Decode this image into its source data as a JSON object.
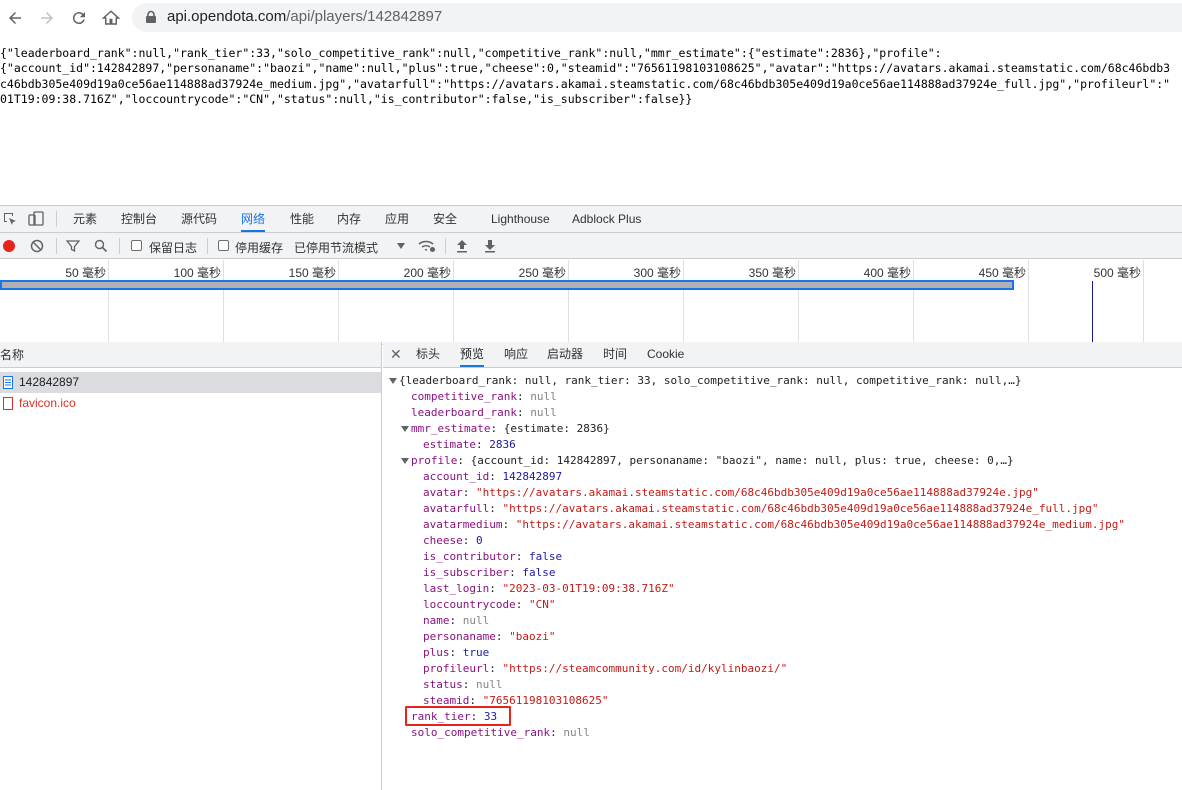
{
  "address_bar": {
    "host": "api.opendota.com",
    "path": "/api/players/142842897"
  },
  "raw_json_lines": [
    "{\"leaderboard_rank\":null,\"rank_tier\":33,\"solo_competitive_rank\":null,\"competitive_rank\":null,\"mmr_estimate\":{\"estimate\":2836},\"profile\":",
    "{\"account_id\":142842897,\"personaname\":\"baozi\",\"name\":null,\"plus\":true,\"cheese\":0,\"steamid\":\"76561198103108625\",\"avatar\":\"https://avatars.akamai.steamstatic.com/68c46bdb3",
    "c46bdb305e409d19a0ce56ae114888ad37924e_medium.jpg\",\"avatarfull\":\"https://avatars.akamai.steamstatic.com/68c46bdb305e409d19a0ce56ae114888ad37924e_full.jpg\",\"profileurl\":\"",
    "01T19:09:38.716Z\",\"loccountrycode\":\"CN\",\"status\":null,\"is_contributor\":false,\"is_subscriber\":false}}"
  ],
  "devtools": {
    "tabs": [
      "元素",
      "控制台",
      "源代码",
      "网络",
      "性能",
      "内存",
      "应用",
      "安全",
      "Lighthouse",
      "Adblock Plus"
    ],
    "active_tab": "网络",
    "toolbar": {
      "preserve_log": "保留日志",
      "disable_cache": "停用缓存",
      "throttling": "已停用节流模式"
    },
    "overview_ticks": [
      "50 毫秒",
      "100 毫秒",
      "150 毫秒",
      "200 毫秒",
      "250 毫秒",
      "300 毫秒",
      "350 毫秒",
      "400 毫秒",
      "450 毫秒",
      "500 毫秒"
    ],
    "request_list": {
      "header": "名称",
      "requests": [
        {
          "name": "142842897",
          "selected": true,
          "failed": false
        },
        {
          "name": "favicon.ico",
          "selected": false,
          "failed": true
        }
      ]
    },
    "detail_tabs": [
      "标头",
      "预览",
      "响应",
      "启动器",
      "时间",
      "Cookie"
    ],
    "active_detail_tab": "预览",
    "preview": {
      "root_summary": "{leaderboard_rank: null, rank_tier: 33, solo_competitive_rank: null, competitive_rank: null,…}",
      "competitive_rank": {
        "key": "competitive_rank",
        "value": "null"
      },
      "leaderboard_rank": {
        "key": "leaderboard_rank",
        "value": "null"
      },
      "mmr_estimate": {
        "key": "mmr_estimate",
        "summary": "{estimate: 2836}"
      },
      "estimate": {
        "key": "estimate",
        "value": "2836"
      },
      "profile": {
        "key": "profile",
        "summary": "{account_id: 142842897, personaname: \"baozi\", name: null, plus: true, cheese: 0,…}"
      },
      "profile_fields": [
        {
          "key": "account_id",
          "value": "142842897",
          "type": "num"
        },
        {
          "key": "avatar",
          "value": "\"https://avatars.akamai.steamstatic.com/68c46bdb305e409d19a0ce56ae114888ad37924e.jpg\"",
          "type": "str"
        },
        {
          "key": "avatarfull",
          "value": "\"https://avatars.akamai.steamstatic.com/68c46bdb305e409d19a0ce56ae114888ad37924e_full.jpg\"",
          "type": "str"
        },
        {
          "key": "avatarmedium",
          "value": "\"https://avatars.akamai.steamstatic.com/68c46bdb305e409d19a0ce56ae114888ad37924e_medium.jpg\"",
          "type": "str"
        },
        {
          "key": "cheese",
          "value": "0",
          "type": "num"
        },
        {
          "key": "is_contributor",
          "value": "false",
          "type": "bool"
        },
        {
          "key": "is_subscriber",
          "value": "false",
          "type": "bool"
        },
        {
          "key": "last_login",
          "value": "\"2023-03-01T19:09:38.716Z\"",
          "type": "str"
        },
        {
          "key": "loccountrycode",
          "value": "\"CN\"",
          "type": "str"
        },
        {
          "key": "name",
          "value": "null",
          "type": "null"
        },
        {
          "key": "personaname",
          "value": "\"baozi\"",
          "type": "str"
        },
        {
          "key": "plus",
          "value": "true",
          "type": "bool"
        },
        {
          "key": "profileurl",
          "value": "\"https://steamcommunity.com/id/kylinbaozi/\"",
          "type": "str"
        },
        {
          "key": "status",
          "value": "null",
          "type": "null"
        },
        {
          "key": "steamid",
          "value": "\"76561198103108625\"",
          "type": "str"
        }
      ],
      "rank_tier": {
        "key": "rank_tier",
        "value": "33"
      },
      "solo_competitive_rank": {
        "key": "solo_competitive_rank",
        "value": "null"
      }
    }
  },
  "colors": {
    "active_tab": "#1a73e8",
    "highlight_box": "#e8231b",
    "record_button": "#e8231b",
    "error_text": "#d93025"
  }
}
